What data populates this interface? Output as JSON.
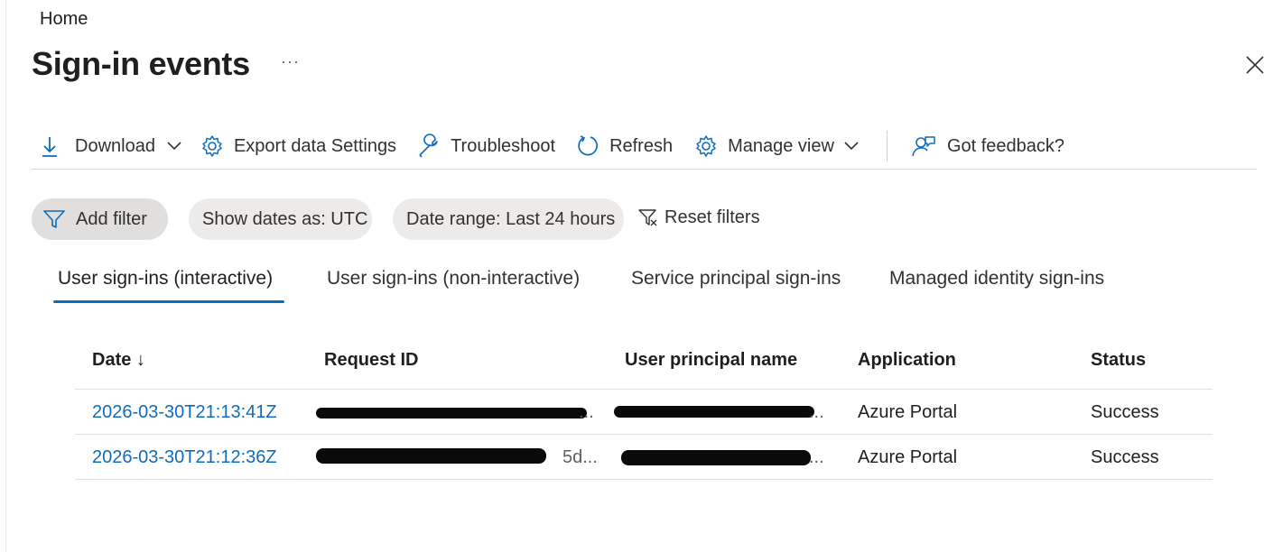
{
  "breadcrumb": "Home",
  "page": {
    "title": "Sign-in events",
    "more": "···"
  },
  "toolbar": {
    "download": "Download",
    "export": "Export data Settings",
    "troubleshoot": "Troubleshoot",
    "refresh": "Refresh",
    "manage_view": "Manage view",
    "feedback": "Got feedback?"
  },
  "filters": {
    "add": "Add filter",
    "dates": "Show dates as: UTC",
    "range": "Date range: Last 24 hours",
    "reset": "Reset filters"
  },
  "tabs": [
    {
      "label": "User sign-ins (interactive)",
      "active": true
    },
    {
      "label": "User sign-ins (non-interactive)"
    },
    {
      "label": "Service principal sign-ins"
    },
    {
      "label": "Managed identity sign-ins"
    }
  ],
  "table": {
    "headers": [
      "Date ↓",
      "Request ID",
      "User principal name",
      "Application",
      "Status"
    ],
    "rows": [
      {
        "date": "2026-03-30T21:13:41Z",
        "request_tail": "...",
        "upn_tail": "...",
        "application": "Azure Portal",
        "status": "Success"
      },
      {
        "date": "2026-03-30T21:12:36Z",
        "request_tail": "5d...",
        "upn_tail": "...",
        "application": "Azure Portal",
        "status": "Success"
      }
    ]
  },
  "colors": {
    "accent": "#0f6cbd",
    "pill_bg": "#edebe9",
    "text": "#201f1e"
  }
}
